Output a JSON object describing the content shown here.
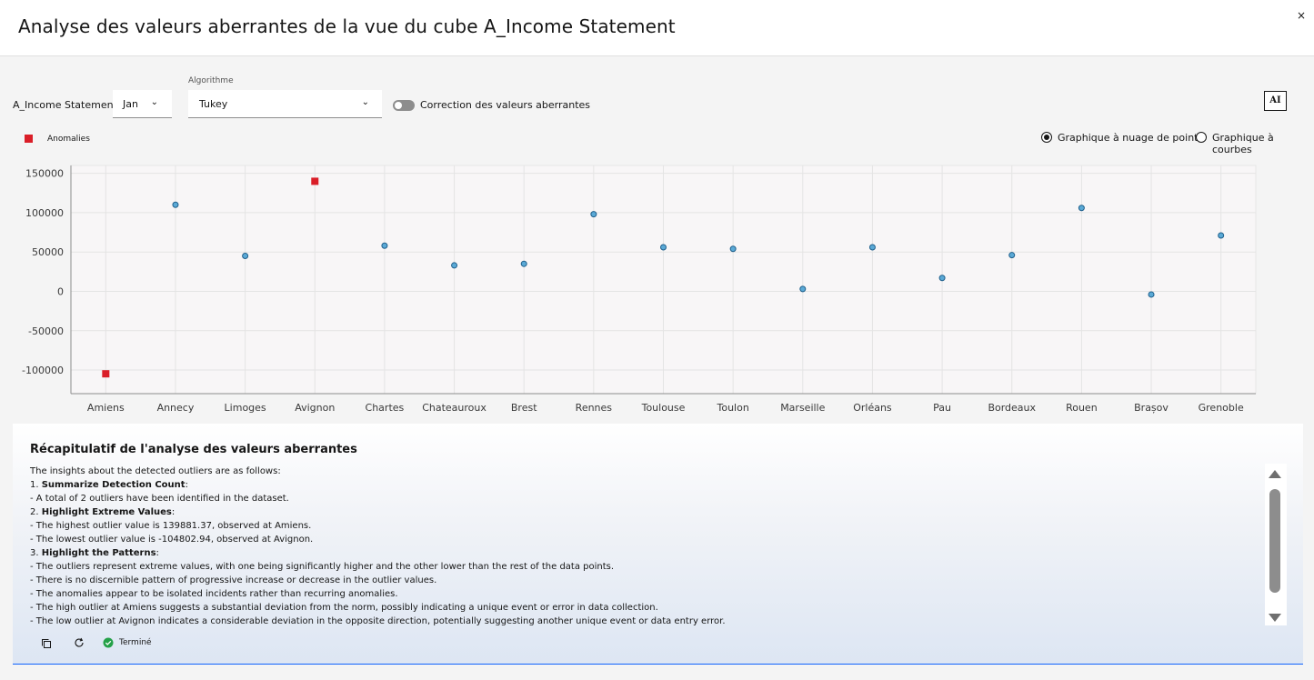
{
  "dialog": {
    "title": "Analyse des valeurs aberrantes de la vue du cube A_Income Statement",
    "close_label": "×"
  },
  "controls": {
    "dimension_label": "A_Income Statement/",
    "dimension_value": "Jan",
    "algorithm_label": "Algorithme",
    "algorithm_value": "Tukey",
    "correction_label": "Correction des valeurs aberrantes",
    "correction_enabled": false,
    "ai_button": "AI"
  },
  "legend": {
    "anomalies_label": "Anomalies",
    "anomaly_color": "#da1e28",
    "point_color": "#5aa9d6"
  },
  "view_options": {
    "scatter_label": "Graphique à nuage de points",
    "line_label": "Graphique à courbes",
    "selected": "scatter"
  },
  "chart_data": {
    "type": "scatter",
    "title": "",
    "xlabel": "",
    "ylabel": "",
    "categories": [
      "Amiens",
      "Annecy",
      "Limoges",
      "Avignon",
      "Chartes",
      "Chateauroux",
      "Brest",
      "Rennes",
      "Toulouse",
      "Toulon",
      "Marseille",
      "Orléans",
      "Pau",
      "Bordeaux",
      "Rouen",
      "Brașov",
      "Grenoble"
    ],
    "values": [
      -104802.94,
      110000,
      45000,
      139881.37,
      58000,
      33000,
      35000,
      98000,
      56000,
      54000,
      3000,
      56000,
      17000,
      46000,
      106000,
      -4000,
      71000
    ],
    "anomalies": [
      true,
      false,
      false,
      true,
      false,
      false,
      false,
      false,
      false,
      false,
      false,
      false,
      false,
      false,
      false,
      false,
      false
    ],
    "ylim": [
      -130000,
      160000
    ],
    "yticks": [
      150000,
      100000,
      50000,
      0,
      -50000,
      -100000
    ],
    "ytick_labels": [
      "150000",
      "100000",
      "50000",
      "0",
      "-50000",
      "-100000"
    ],
    "grid": true
  },
  "summary": {
    "title": "Récapitulatif de l'analyse des valeurs aberrantes",
    "intro": "The insights about the detected outliers are as follows:",
    "s1_num": "1. ",
    "s1_head": "Summarize Detection Count",
    "s1_l1": "- A total of 2 outliers have been identified in the dataset.",
    "s2_num": "2. ",
    "s2_head": "Highlight Extreme Values",
    "s2_l1": "- The highest outlier value is 139881.37, observed at Amiens.",
    "s2_l2": "- The lowest outlier value is -104802.94, observed at Avignon.",
    "s3_num": "3. ",
    "s3_head": "Highlight the Patterns",
    "s3_l1": "- The outliers represent extreme values, with one being significantly higher and the other lower than the rest of the data points.",
    "s3_l2": "- There is no discernible pattern of progressive increase or decrease in the outlier values.",
    "s3_l3": "- The anomalies appear to be isolated incidents rather than recurring anomalies.",
    "s3_l4": "- The high outlier at Amiens suggests a substantial deviation from the norm, possibly indicating a unique event or error in data collection.",
    "s3_l5": "- The low outlier at Avignon indicates a considerable deviation in the opposite direction, potentially suggesting another unique event or data entry error.",
    "status_label": "Terminé"
  }
}
